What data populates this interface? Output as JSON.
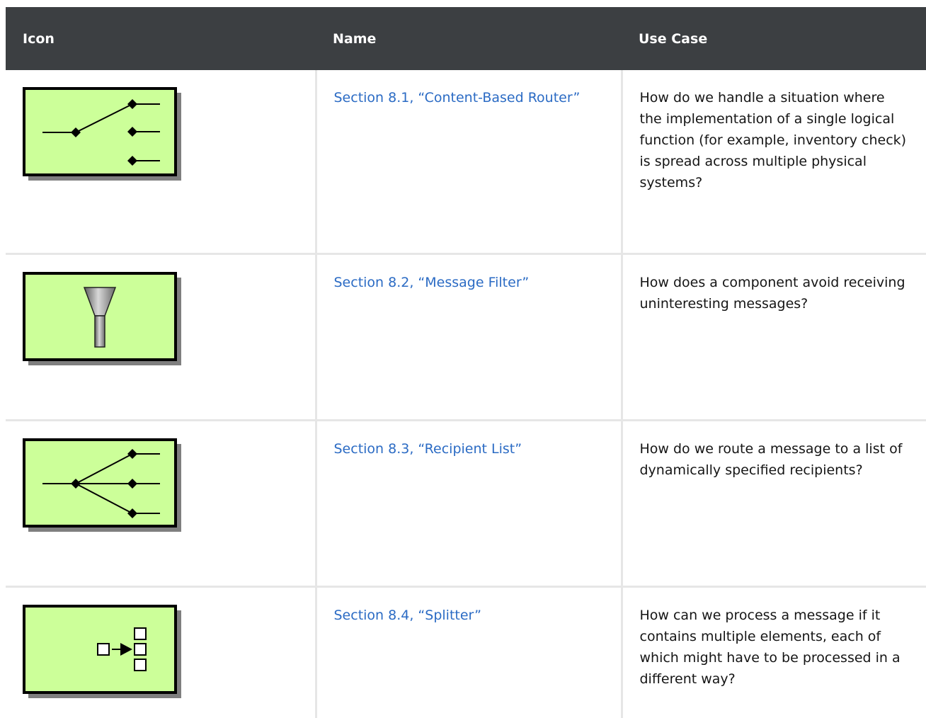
{
  "table": {
    "headers": {
      "icon": "Icon",
      "name": "Name",
      "use_case": "Use Case"
    },
    "rows": [
      {
        "icon": "content-based-router-icon",
        "name": "Section 8.1, “Content-Based Router”",
        "use_case": "How do we handle a situation where the implementation of a single logical function (for example, inventory check) is spread across multiple physical systems?"
      },
      {
        "icon": "message-filter-icon",
        "name": "Section 8.2, “Message Filter”",
        "use_case": "How does a component avoid receiving uninteresting messages?"
      },
      {
        "icon": "recipient-list-icon",
        "name": "Section 8.3, “Recipient List”",
        "use_case": "How do we route a message to a list of dynamically specified recipients?"
      },
      {
        "icon": "splitter-icon",
        "name": "Section 8.4, “Splitter”",
        "use_case": "How can we process a message if it contains multiple elements, each of which might have to be processed in a different way?"
      }
    ]
  },
  "colors": {
    "header_bg": "#3c3f42",
    "link": "#2b6bc4",
    "icon_fill": "#ccff99"
  }
}
